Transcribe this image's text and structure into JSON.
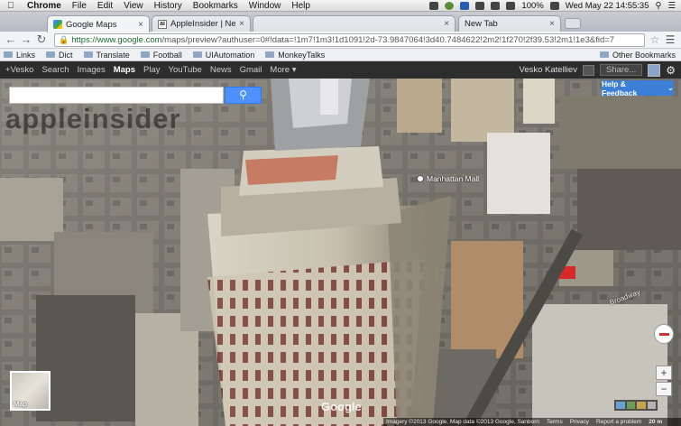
{
  "menubar": {
    "apple": "",
    "app": "Chrome",
    "items": [
      "File",
      "Edit",
      "View",
      "History",
      "Bookmarks",
      "Window",
      "Help"
    ],
    "battery": "100%",
    "clock": "Wed May 22  14:55:35"
  },
  "tabs": [
    {
      "title": "Google Maps",
      "favicon": "google-maps-icon",
      "active": true
    },
    {
      "title": "AppleInsider | News and ru",
      "favicon": "appleinsider-icon",
      "active": false
    },
    {
      "title": "",
      "favicon": "",
      "active": false
    },
    {
      "title": "New Tab",
      "favicon": "",
      "active": false
    }
  ],
  "toolbar": {
    "url_host": "https://www.google.com",
    "url_path": "/maps/preview?authuser=0#!data=!1m7!1m3!1d1091!2d-73.9847064!3d40.7484622!2m2!1f270!2f39.53!2m1!1e3&fid=7"
  },
  "bookmarks": {
    "items": [
      "Links",
      "Dict",
      "Translate",
      "Football",
      "UIAutomation",
      "MonkeyTalks"
    ],
    "other": "Other Bookmarks"
  },
  "gbar": {
    "items": [
      "+Vesko",
      "Search",
      "Images",
      "Maps",
      "Play",
      "YouTube",
      "News",
      "Gmail",
      "More ▾"
    ],
    "active_index": 3,
    "user": "Vesko Katelliev",
    "share": "Share..."
  },
  "map": {
    "watermark": "appleinsider",
    "help_feedback": "Help & Feedback",
    "poi_label": "Manhattan Mall",
    "street": "Broadway",
    "minimap_label": "Map",
    "google_logo": "Google",
    "footer": {
      "imagery": "Imagery ©2013 Google, Map data ©2013 Google, Sanborn",
      "terms": "Terms",
      "privacy": "Privacy",
      "report": "Report a problem",
      "scale": "20 m"
    },
    "zoom_in": "+",
    "zoom_out": "−"
  }
}
